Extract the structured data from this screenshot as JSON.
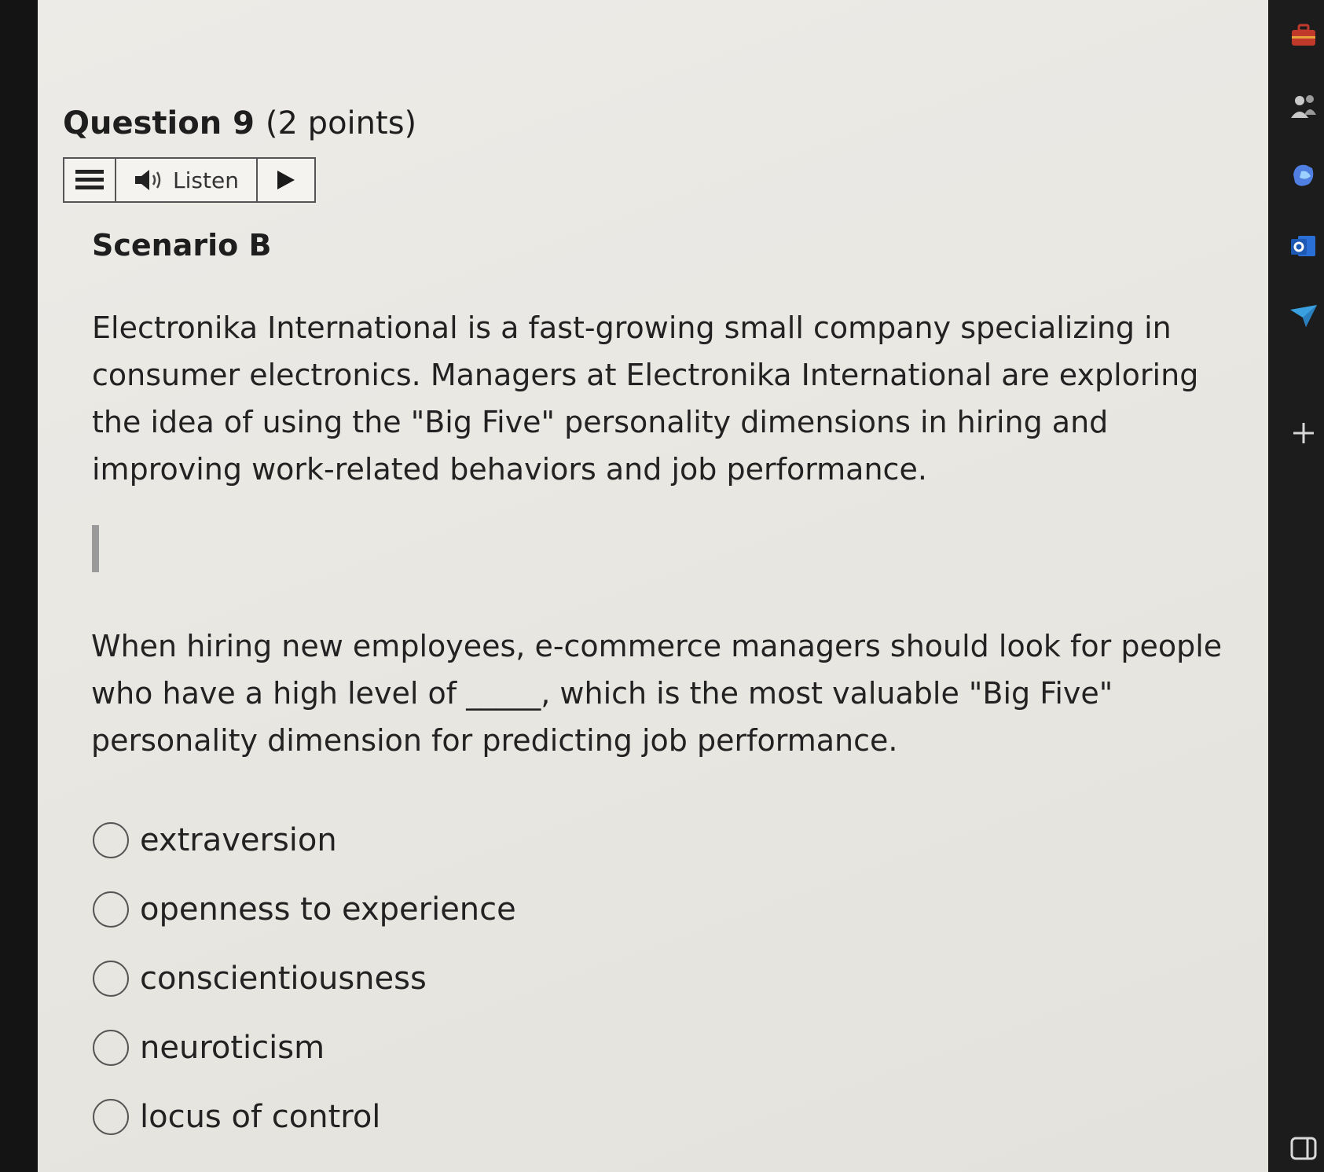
{
  "question": {
    "title": "Question 9",
    "points": "(2 points)"
  },
  "listen": {
    "label": "Listen"
  },
  "scenario": {
    "heading": "Scenario B",
    "text": "Electronika International is a fast-growing small company specializing in consumer electronics. Managers at Electronika International are exploring the idea of using the \"Big Five\" personality dimensions in hiring and improving work-related behaviors and job performance."
  },
  "prompt": "When hiring new employees, e-commerce managers should look for people who have a high level of _____, which is the most valuable \"Big Five\" personality dimension for predicting job performance.",
  "options": [
    {
      "label": "extraversion"
    },
    {
      "label": "openness to experience"
    },
    {
      "label": "conscientiousness"
    },
    {
      "label": "neuroticism"
    },
    {
      "label": "locus of control"
    }
  ],
  "side_icons": [
    "briefcase-icon",
    "people-icon",
    "copilot-icon",
    "outlook-icon",
    "send-icon",
    "plus-icon",
    "sidebar-toggle-icon"
  ]
}
